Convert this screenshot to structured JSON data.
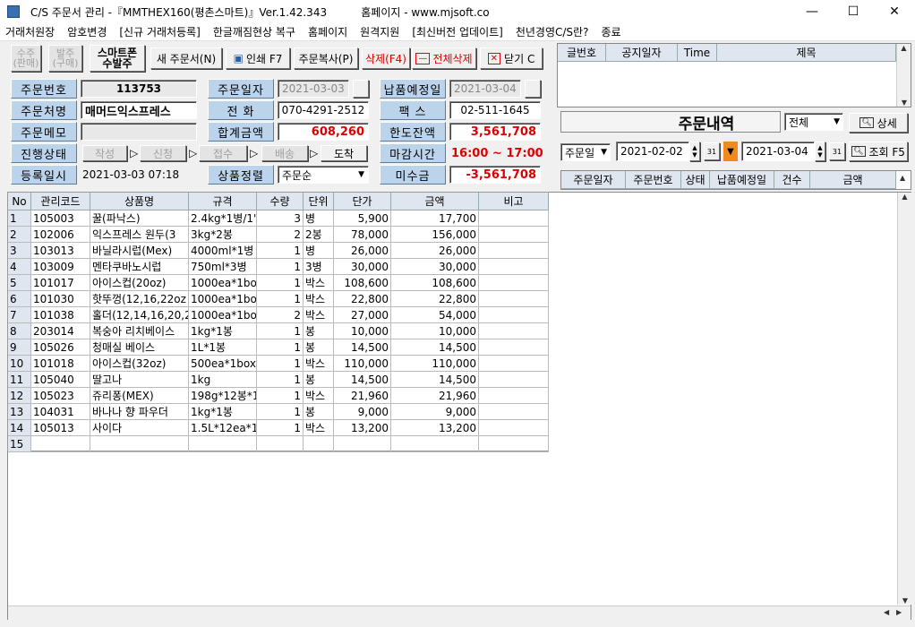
{
  "window": {
    "title": "C/S 주문서 관리 -『MMTHEX160(평촌스마트)』Ver.1.42.343          홈페이지 - www.mjsoft.co"
  },
  "menu": [
    "거래처원장",
    "암호변경",
    "[신규 거래처등록]",
    "한글깨짐현상 복구",
    "홈페이지",
    "원격지원",
    "[최신버전 업데이트]",
    "천년경영C/S란?",
    "종료"
  ],
  "toolbar": {
    "sales": "수주\n(판매)",
    "purchase": "발주\n(구매)",
    "smartphone": "스마트폰\n수발주",
    "new": "새 주문서(N)",
    "print": "인쇄 F7",
    "copy": "주문복사(P)",
    "delete": "삭제(F4)",
    "delete_all": "전체삭제",
    "close": "닫기 C"
  },
  "form": {
    "order_no_label": "주문번호",
    "order_no": "113753",
    "order_date_label": "주문일자",
    "order_date": "2021-03-03",
    "delivery_label": "납품예정일",
    "delivery": "2021-03-04",
    "orderer_label": "주문처명",
    "orderer": "매머드익스프레스",
    "phone_label": "전    화",
    "phone": "070-4291-2512",
    "fax_label": "팩    스",
    "fax": "02-511-1645",
    "memo_label": "주문메모",
    "total_label": "합계금액",
    "total": "608,260",
    "limit_label": "한도잔액",
    "limit": "3,561,708",
    "status_label": "진행상태",
    "status_steps": [
      "작성",
      "신청",
      "접수",
      "배송",
      "도착"
    ],
    "deadline_label": "마감시간",
    "deadline": "16:00 ~ 17:00",
    "reg_label": "등록일시",
    "reg": "2021-03-03 07:18",
    "sort_label": "상품정렬",
    "sort": "주문순",
    "unpaid_label": "미수금",
    "unpaid": "-3,561,708"
  },
  "notice": {
    "headers": [
      "글번호",
      "공지일자",
      "Time",
      "제목"
    ]
  },
  "orders": {
    "title": "주문내역",
    "filter": "전체",
    "detail": "상세",
    "date_type": "주문일",
    "from": "2021-02-02",
    "to": "2021-03-04",
    "search": "조회 F5",
    "headers": [
      "주문일자",
      "주문번호",
      "상태",
      "납품예정일",
      "건수",
      "금액"
    ]
  },
  "table": {
    "headers": [
      "No",
      "관리코드",
      "상품명",
      "규격",
      "수량",
      "단위",
      "단가",
      "금액",
      "비고"
    ],
    "rows": [
      [
        "1",
        "105003",
        "꿀(파낙스)",
        "2.4kg*1병/1'",
        "3",
        "병",
        "5,900",
        "17,700",
        ""
      ],
      [
        "2",
        "102006",
        "익스프레스 원두(3",
        "3kg*2봉",
        "2",
        "2봉",
        "78,000",
        "156,000",
        ""
      ],
      [
        "3",
        "103013",
        "바닐라시럽(Mex)",
        "4000ml*1병",
        "1",
        "병",
        "26,000",
        "26,000",
        ""
      ],
      [
        "4",
        "103009",
        "멘타쿠바노시럽",
        "750ml*3병",
        "1",
        "3병",
        "30,000",
        "30,000",
        ""
      ],
      [
        "5",
        "101017",
        "아이스컵(20oz)",
        "1000ea*1bo",
        "1",
        "박스",
        "108,600",
        "108,600",
        ""
      ],
      [
        "6",
        "101030",
        "핫뚜껑(12,16,22oz",
        "1000ea*1bo",
        "1",
        "박스",
        "22,800",
        "22,800",
        ""
      ],
      [
        "7",
        "101038",
        "홀더(12,14,16,20,2",
        "1000ea*1bo",
        "2",
        "박스",
        "27,000",
        "54,000",
        ""
      ],
      [
        "8",
        "203014",
        "복숭아 리치베이스",
        "1kg*1봉",
        "1",
        "봉",
        "10,000",
        "10,000",
        ""
      ],
      [
        "9",
        "105026",
        "청매실 베이스",
        "1L*1봉",
        "1",
        "봉",
        "14,500",
        "14,500",
        ""
      ],
      [
        "10",
        "101018",
        "아이스컵(32oz)",
        "500ea*1box",
        "1",
        "박스",
        "110,000",
        "110,000",
        ""
      ],
      [
        "11",
        "105040",
        "딸고나",
        "1kg",
        "1",
        "봉",
        "14,500",
        "14,500",
        ""
      ],
      [
        "12",
        "105023",
        "쥬리퐁(MEX)",
        "198g*12봉*1",
        "1",
        "박스",
        "21,960",
        "21,960",
        ""
      ],
      [
        "13",
        "104031",
        "바나나 향 파우더",
        "1kg*1봉",
        "1",
        "봉",
        "9,000",
        "9,000",
        ""
      ],
      [
        "14",
        "105013",
        "사이다",
        "1.5L*12ea*1",
        "1",
        "박스",
        "13,200",
        "13,200",
        ""
      ],
      [
        "15",
        "",
        "",
        "",
        "",
        "",
        "",
        "",
        ""
      ]
    ]
  }
}
